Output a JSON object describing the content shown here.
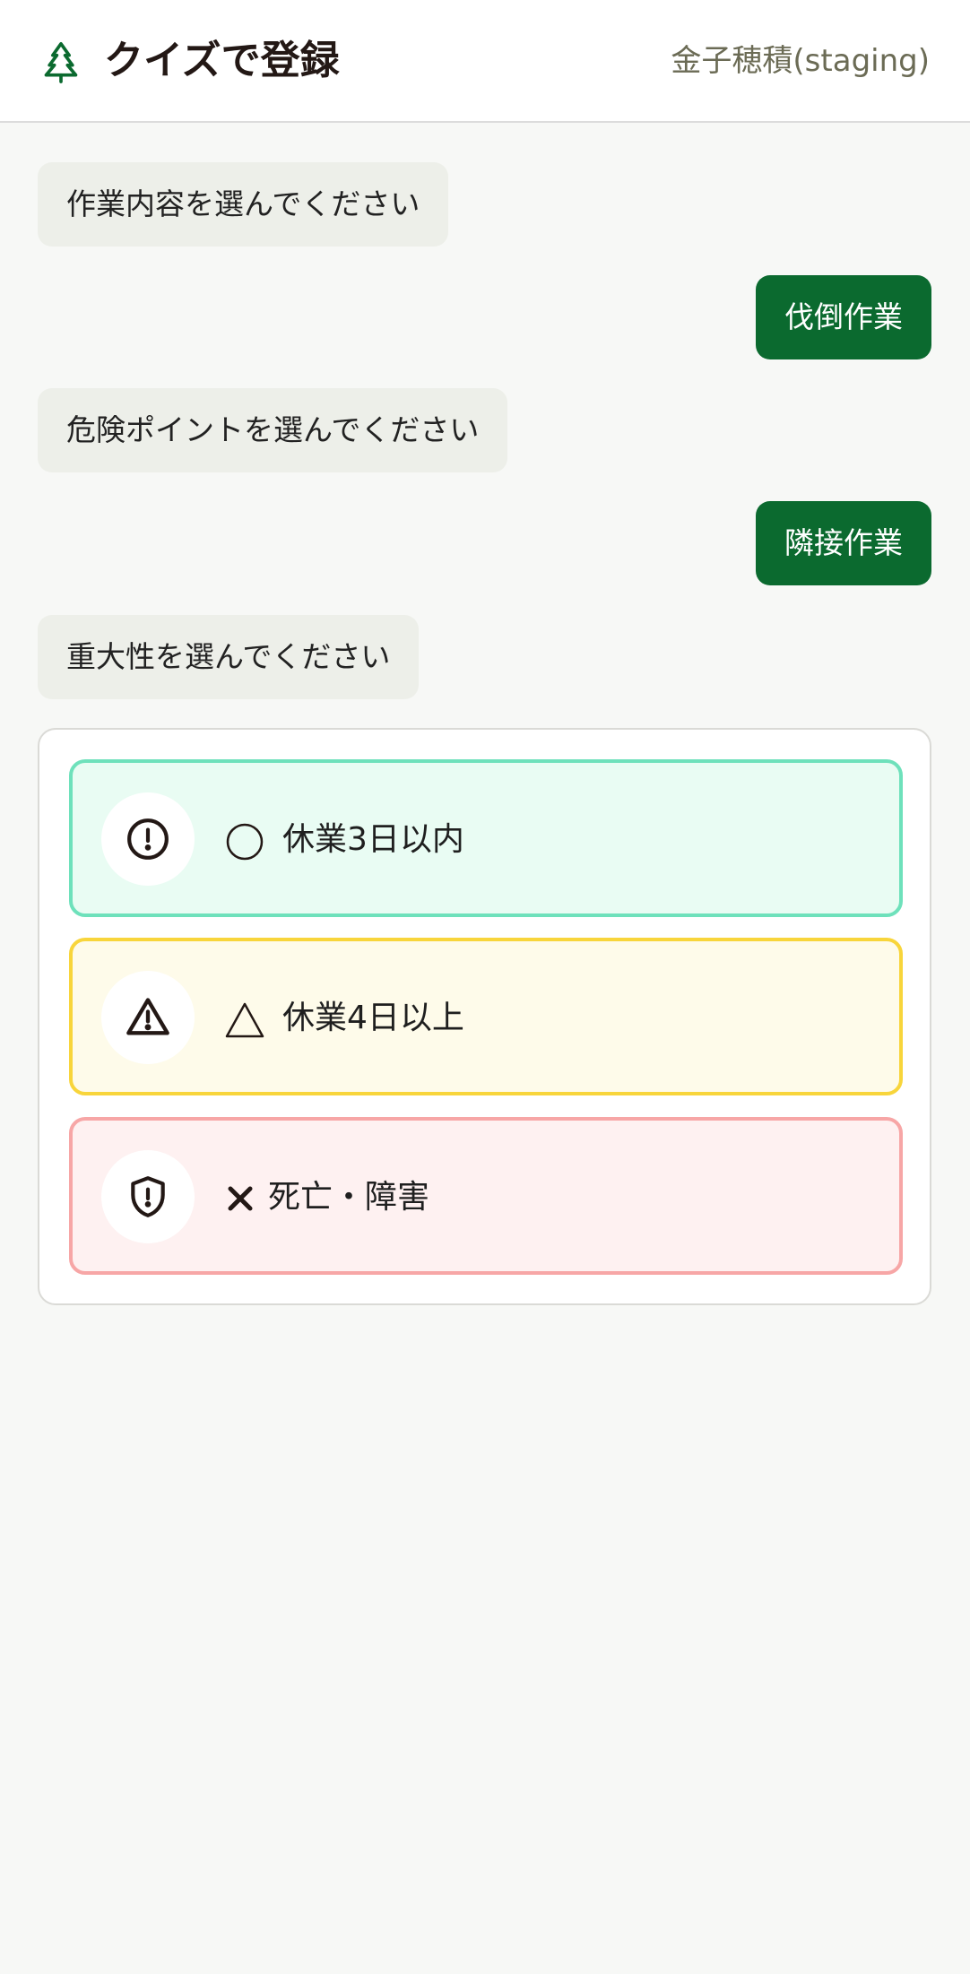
{
  "header": {
    "title": "クイズで登録",
    "user": "金子穂積(staging)",
    "logo_icon": "tree-icon"
  },
  "chat": [
    {
      "role": "bot",
      "text": "作業内容を選んでください"
    },
    {
      "role": "user",
      "text": "伐倒作業"
    },
    {
      "role": "bot",
      "text": "危険ポイントを選んでください"
    },
    {
      "role": "user",
      "text": "隣接作業"
    },
    {
      "role": "bot",
      "text": "重大性を選んでください"
    }
  ],
  "options": [
    {
      "label": "休業3日以内",
      "icon": "alert-circle-icon",
      "symbol": "circle-mark-icon",
      "color": "#6ee1bb"
    },
    {
      "label": "休業4日以上",
      "icon": "alert-triangle-icon",
      "symbol": "triangle-mark-icon",
      "color": "#f8d53b"
    },
    {
      "label": "死亡・障害",
      "icon": "shield-alert-icon",
      "symbol": "cross-mark-icon",
      "color": "#f7a6a6"
    }
  ],
  "colors": {
    "brand": "#0b6a2f",
    "bot_bubble": "#edefe9",
    "background": "#f7f8f6"
  }
}
